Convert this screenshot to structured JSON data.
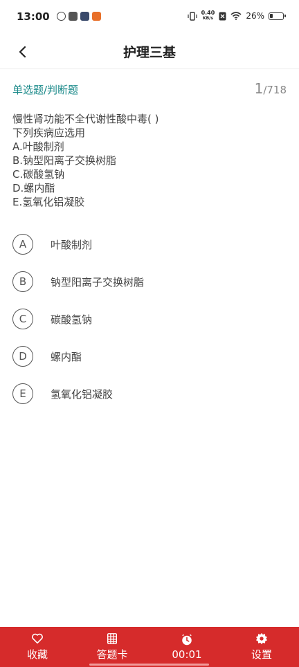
{
  "status": {
    "time": "13:00",
    "net_speed_value": "0.40",
    "net_speed_unit": "KB/s",
    "battery": "26%",
    "battery_level": 0.26
  },
  "header": {
    "title": "护理三基"
  },
  "question": {
    "type": "单选题/判断题",
    "current": "1",
    "total": "/718",
    "lines": [
      "慢性肾功能不全代谢性酸中毒( )",
      "下列疾病应选用",
      "A.叶酸制剂",
      "B.钠型阳离子交换树脂",
      "C.碳酸氢钠",
      "D.螺内酯",
      "E.氢氧化铝凝胶"
    ]
  },
  "options": [
    {
      "letter": "A",
      "text": "叶酸制剂"
    },
    {
      "letter": "B",
      "text": "钠型阳离子交换树脂"
    },
    {
      "letter": "C",
      "text": "碳酸氢钠"
    },
    {
      "letter": "D",
      "text": "螺内酯"
    },
    {
      "letter": "E",
      "text": "氢氧化铝凝胶"
    }
  ],
  "bottom_bar": {
    "favorite": "收藏",
    "answer_card": "答题卡",
    "timer": "00:01",
    "settings": "设置"
  },
  "colors": {
    "accent": "#d62b2b",
    "type_label": "#1b8a8a"
  },
  "icons": {
    "back": "chevron-left-icon",
    "favorite": "heart-icon",
    "answer_card": "grid-icon",
    "timer": "clock-icon",
    "settings": "gear-icon"
  }
}
